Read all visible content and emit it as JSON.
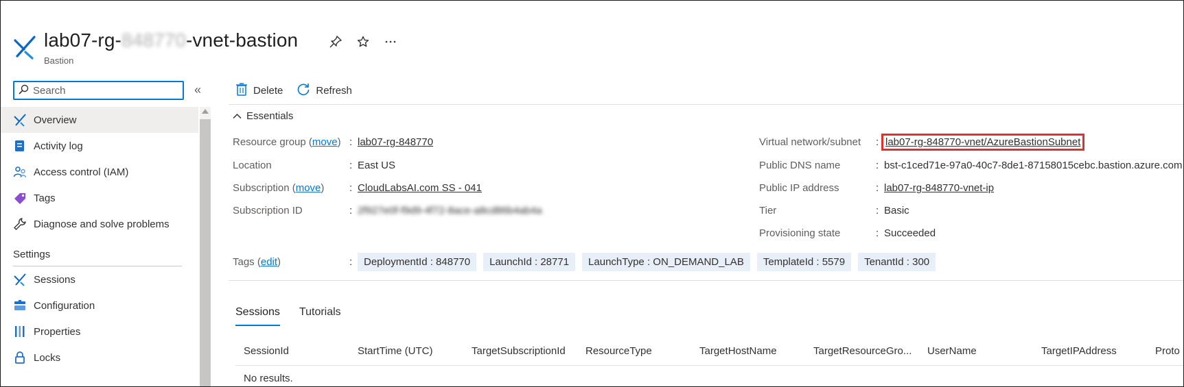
{
  "header": {
    "title_prefix": "lab07-rg-",
    "title_blurred": "848770",
    "title_suffix": "-vnet-bastion",
    "subtitle": "Bastion",
    "icons": [
      "pin-icon",
      "star-icon",
      "more-icon"
    ]
  },
  "sidebar": {
    "search_placeholder": "Search",
    "collapse_glyph": "«",
    "items": [
      {
        "label": "Overview",
        "icon": "bastion-icon",
        "active": true
      },
      {
        "label": "Activity log",
        "icon": "activity-log-icon"
      },
      {
        "label": "Access control (IAM)",
        "icon": "iam-icon"
      },
      {
        "label": "Tags",
        "icon": "tag-icon"
      },
      {
        "label": "Diagnose and solve problems",
        "icon": "wrench-icon"
      }
    ],
    "settings_heading": "Settings",
    "settings_items": [
      {
        "label": "Sessions",
        "icon": "bastion-icon"
      },
      {
        "label": "Configuration",
        "icon": "configuration-icon"
      },
      {
        "label": "Properties",
        "icon": "properties-icon"
      },
      {
        "label": "Locks",
        "icon": "lock-icon"
      }
    ]
  },
  "toolbar": {
    "delete_label": "Delete",
    "refresh_label": "Refresh"
  },
  "essentials": {
    "heading": "Essentials",
    "left": {
      "resource_group_label": "Resource group",
      "move_label": "move",
      "resource_group_value": "lab07-rg-848770",
      "location_label": "Location",
      "location_value": "East US",
      "subscription_label": "Subscription",
      "subscription_value": "CloudLabsAI.com SS - 041",
      "subscription_id_label": "Subscription ID",
      "subscription_id_value": "2f927e0f-f9d9-4f72-8ace-a8cd86b4ab4a"
    },
    "right": {
      "vnet_label": "Virtual network/subnet",
      "vnet_value": "lab07-rg-848770-vnet/AzureBastionSubnet",
      "dns_label": "Public DNS name",
      "dns_value": "bst-c1ced71e-97a0-40c7-8de1-87158015cebc.bastion.azure.com",
      "ip_label": "Public IP address",
      "ip_value": "lab07-rg-848770-vnet-ip",
      "tier_label": "Tier",
      "tier_value": "Basic",
      "prov_label": "Provisioning state",
      "prov_value": "Succeeded"
    },
    "tags_label": "Tags",
    "tags_edit": "edit",
    "tags": [
      "DeploymentId : 848770",
      "LaunchId : 28771",
      "LaunchType : ON_DEMAND_LAB",
      "TemplateId : 5579",
      "TenantId : 300"
    ]
  },
  "tabs": [
    "Sessions",
    "Tutorials"
  ],
  "table": {
    "columns": [
      "SessionId",
      "StartTime (UTC)",
      "TargetSubscriptionId",
      "ResourceType",
      "TargetHostName",
      "TargetResourceGro...",
      "UserName",
      "TargetIPAddress",
      "Proto"
    ],
    "empty_text": "No results."
  },
  "colors": {
    "accent": "#0078d4",
    "highlight_box": "#e03131",
    "tag_bg": "#e9eff8"
  }
}
